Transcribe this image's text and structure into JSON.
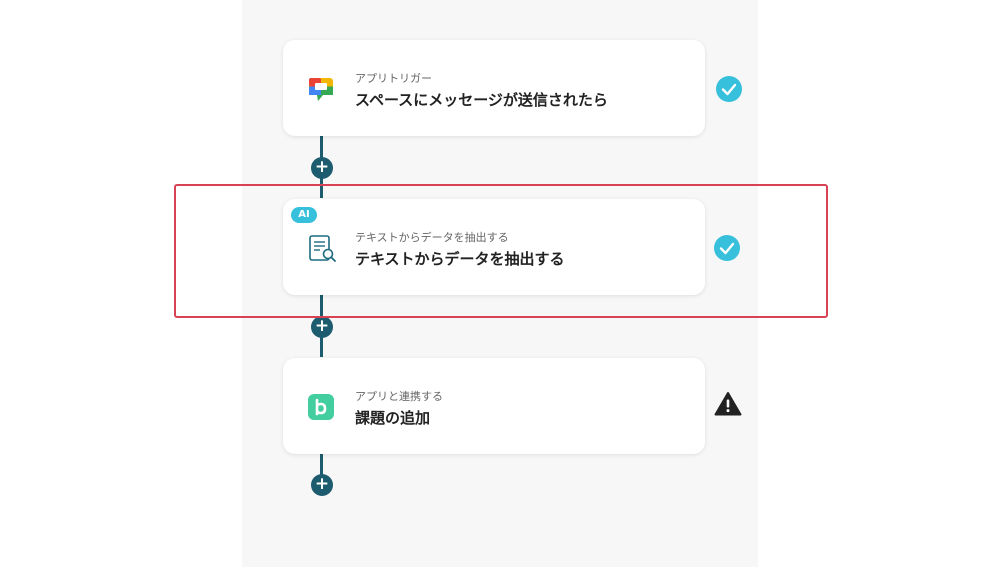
{
  "flow": {
    "steps": [
      {
        "subtitle": "アプリトリガー",
        "title": "スペースにメッセージが送信されたら",
        "icon": "google-chat-icon",
        "status": "complete"
      },
      {
        "badge": "AI",
        "subtitle": "テキストからデータを抽出する",
        "title": "テキストからデータを抽出する",
        "icon": "document-search-icon",
        "status": "complete"
      },
      {
        "subtitle": "アプリと連携する",
        "title": "課題の追加",
        "icon": "backlog-icon",
        "status": "warning"
      }
    ],
    "add_symbol": "+"
  },
  "colors": {
    "connector": "#1d5c6e",
    "check": "#37c0dc",
    "highlight": "#d84255",
    "backlog": "#42ce9f"
  }
}
